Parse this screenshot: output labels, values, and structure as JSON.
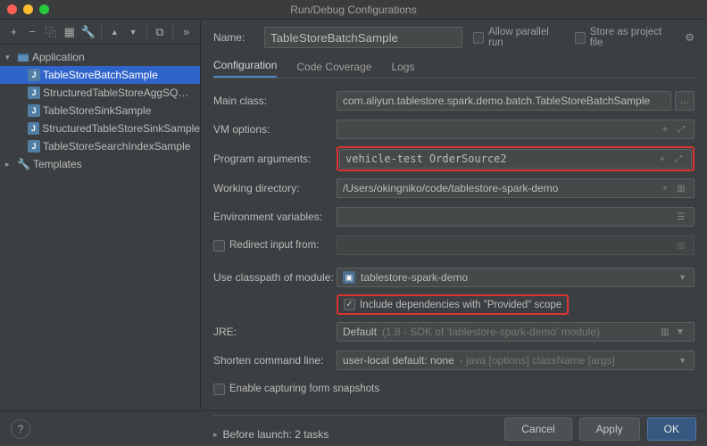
{
  "window": {
    "title": "Run/Debug Configurations"
  },
  "toolbar_icons": {
    "add": "+",
    "remove": "−",
    "copy": "⿻",
    "save": "▦",
    "wrench": "🔧",
    "up": "▲",
    "down": "▼",
    "folder": "⧉",
    "expand": "»"
  },
  "tree": {
    "application_label": "Application",
    "items": [
      "TableStoreBatchSample",
      "StructuredTableStoreAggSQLSample",
      "TableStoreSinkSample",
      "StructuredTableStoreSinkSample",
      "TableStoreSearchIndexSample"
    ],
    "templates_label": "Templates"
  },
  "header": {
    "name_label": "Name:",
    "name_value": "TableStoreBatchSample",
    "allow_parallel": "Allow parallel run",
    "store_project": "Store as project file"
  },
  "tabs": {
    "config": "Configuration",
    "coverage": "Code Coverage",
    "logs": "Logs"
  },
  "form": {
    "main_class_label": "Main class:",
    "main_class_value": "com.aliyun.tablestore.spark.demo.batch.TableStoreBatchSample",
    "vm_options_label": "VM options:",
    "vm_options_value": "",
    "program_args_label": "Program arguments:",
    "program_args_value": "vehicle-test OrderSource2",
    "working_dir_label": "Working directory:",
    "working_dir_value": "/Users/okingniko/code/tablestore-spark-demo",
    "env_vars_label": "Environment variables:",
    "env_vars_value": "",
    "redirect_label": "Redirect input from:",
    "classpath_label": "Use classpath of module:",
    "classpath_value": "tablestore-spark-demo",
    "include_deps": "Include dependencies with \"Provided\" scope",
    "jre_label": "JRE:",
    "jre_value": "Default",
    "jre_hint": "(1.8 - SDK of 'tablestore-spark-demo' module)",
    "shorten_label": "Shorten command line:",
    "shorten_value": "user-local default: none",
    "shorten_hint": "- java [options] className [args]",
    "capture_label": "Enable capturing form snapshots"
  },
  "before_launch": {
    "label": "Before launch: 2 tasks"
  },
  "footer": {
    "cancel": "Cancel",
    "apply": "Apply",
    "ok": "OK"
  }
}
